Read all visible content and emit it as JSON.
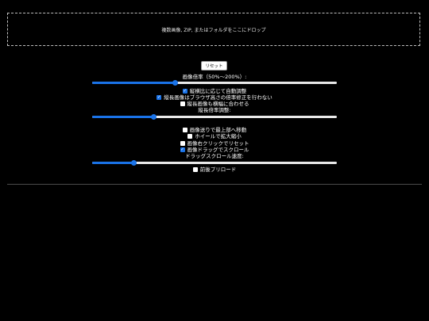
{
  "dropzone": {
    "text": "複数画像, ZIP, またはフォルダをここにドロップ"
  },
  "reset_button": {
    "label": "リセット"
  },
  "zoom": {
    "label": "画像倍率（50%～200%）:",
    "value_fraction": 0.34
  },
  "group1": [
    {
      "id": "auto-fit",
      "label": "縦横比に応じて自動調整",
      "checked": true
    },
    {
      "id": "no-browser-correction",
      "label": "縦長画像はブラウザ高さの倍率修正を行わない",
      "checked": true
    },
    {
      "id": "fit-width",
      "label": "縦長画像も横幅に合わせる",
      "checked": false
    }
  ],
  "vertical_zoom": {
    "label": "縦長倍率調整:",
    "value_fraction": 0.25
  },
  "group2": [
    {
      "id": "scroll-top",
      "label": "画像送りで最上部へ移動",
      "checked": false
    },
    {
      "id": "wheel-zoom",
      "label": "ホイールで拡大縮小",
      "checked": false
    },
    {
      "id": "right-click-reset",
      "label": "画像右クリックでリセット",
      "checked": false
    },
    {
      "id": "drag-scroll",
      "label": "画像ドラッグでスクロール",
      "checked": true
    }
  ],
  "drag_speed": {
    "label": "ドラッグスクロール速度:",
    "value_fraction": 0.17
  },
  "preload": {
    "label": "前後プリロード",
    "checked": false
  },
  "colors": {
    "accent": "#1a73e8",
    "background": "#000000"
  }
}
